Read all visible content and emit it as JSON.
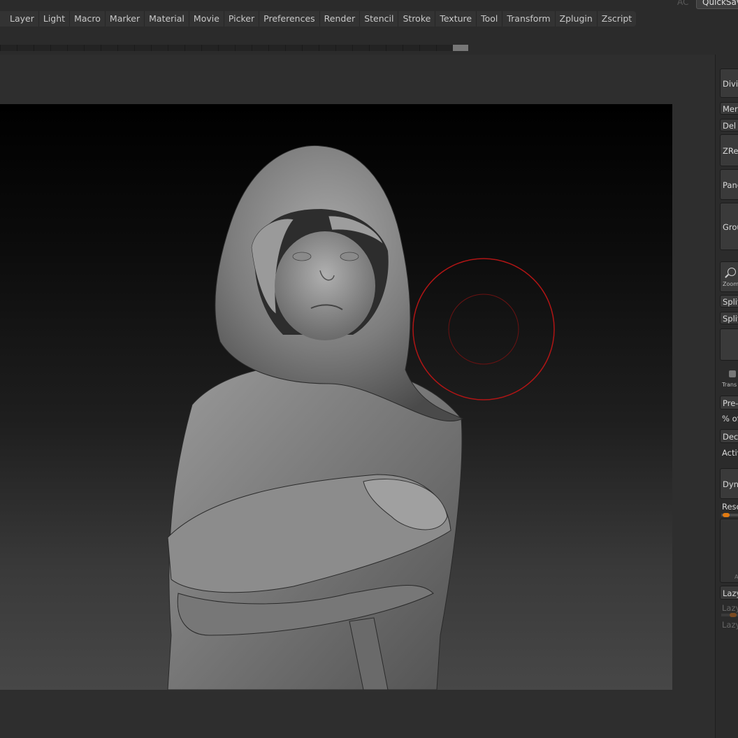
{
  "top": {
    "ac_label": "AC",
    "quicksave_label": "QuickSave"
  },
  "menu": {
    "items": [
      "Layer",
      "Light",
      "Macro",
      "Marker",
      "Material",
      "Movie",
      "Picker",
      "Preferences",
      "Render",
      "Stencil",
      "Stroke",
      "Texture",
      "Tool",
      "Transform",
      "Zplugin",
      "Zscript"
    ]
  },
  "tray": {
    "divide": "Divide",
    "merge": "Mer",
    "del": "Del l",
    "zremesher": "ZRer",
    "panel": "Pane",
    "group": "Grou",
    "zoom": "Zoom",
    "split1": "Split",
    "split2": "Split",
    "transp": "Trans",
    "pre": "Pre-",
    "percent_of": "% of",
    "deci": "Deci",
    "activ": "Activ",
    "dyna": "Dyna",
    "reso": "Reso",
    "box_label": "A",
    "lazy": "Lazy",
    "lazy2": "Lazy",
    "lazy3": "Lazy"
  },
  "colors": {
    "brush_ring": "#b01515",
    "slider_accent": "#e07a12"
  },
  "icons": {
    "zoom": "magnifier-icon",
    "transp": "transparency-icon"
  }
}
